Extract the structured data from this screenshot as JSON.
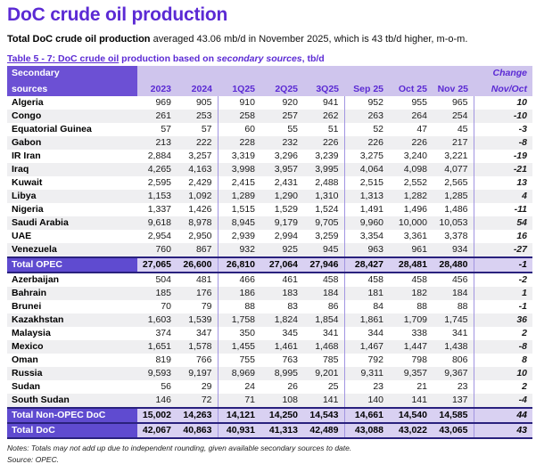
{
  "page": {
    "title": "DoC crude oil production",
    "intro_bold": "Total DoC crude oil production",
    "intro_rest": " averaged 43.06 mb/d in November 2025, which is 43 tb/d higher, m-o-m.",
    "caption_link": "Table 5 - 7: DoC crude oil",
    "caption_mid": " production based on ",
    "caption_italic": "secondary sources",
    "caption_end": ", tb/d",
    "notes": "Notes: Totals may not add up due to independent rounding, given available secondary sources to date.",
    "source": "Source: OPEC."
  },
  "colors": {
    "accent_purple": "#5b2ad4",
    "header_block_purple": "#6c50d4",
    "total_label_purple": "#5f4bd0",
    "header_lavender": "#cfc5ed",
    "total_lavender": "#d9d1f2",
    "band_gray": "#efeff1",
    "vline_purple": "#a295e1",
    "dark_border": "#29217d"
  },
  "table": {
    "header_label_line1": "Secondary",
    "header_label_line2": "sources",
    "columns": [
      "2023",
      "2024",
      "1Q25",
      "2Q25",
      "3Q25",
      "Sep 25",
      "Oct 25",
      "Nov 25"
    ],
    "change_line1": "Change",
    "change_line2": "Nov/Oct",
    "rows": [
      {
        "type": "data",
        "label": "Algeria",
        "values": [
          "969",
          "905",
          "910",
          "920",
          "941",
          "952",
          "955",
          "965"
        ],
        "change": "10"
      },
      {
        "type": "data",
        "label": "Congo",
        "values": [
          "261",
          "253",
          "258",
          "257",
          "262",
          "263",
          "264",
          "254"
        ],
        "change": "-10"
      },
      {
        "type": "data",
        "label": "Equatorial Guinea",
        "values": [
          "57",
          "57",
          "60",
          "55",
          "51",
          "52",
          "47",
          "45"
        ],
        "change": "-3"
      },
      {
        "type": "data",
        "label": "Gabon",
        "values": [
          "213",
          "222",
          "228",
          "232",
          "226",
          "226",
          "226",
          "217"
        ],
        "change": "-8"
      },
      {
        "type": "data",
        "label": "IR Iran",
        "values": [
          "2,884",
          "3,257",
          "3,319",
          "3,296",
          "3,239",
          "3,275",
          "3,240",
          "3,221"
        ],
        "change": "-19"
      },
      {
        "type": "data",
        "label": "Iraq",
        "values": [
          "4,265",
          "4,163",
          "3,998",
          "3,957",
          "3,995",
          "4,064",
          "4,098",
          "4,077"
        ],
        "change": "-21"
      },
      {
        "type": "data",
        "label": "Kuwait",
        "values": [
          "2,595",
          "2,429",
          "2,415",
          "2,431",
          "2,488",
          "2,515",
          "2,552",
          "2,565"
        ],
        "change": "13"
      },
      {
        "type": "data",
        "label": "Libya",
        "values": [
          "1,153",
          "1,092",
          "1,289",
          "1,290",
          "1,310",
          "1,313",
          "1,282",
          "1,285"
        ],
        "change": "4"
      },
      {
        "type": "data",
        "label": "Nigeria",
        "values": [
          "1,337",
          "1,426",
          "1,515",
          "1,529",
          "1,524",
          "1,491",
          "1,496",
          "1,486"
        ],
        "change": "-11"
      },
      {
        "type": "data",
        "label": "Saudi Arabia",
        "values": [
          "9,618",
          "8,978",
          "8,945",
          "9,179",
          "9,705",
          "9,960",
          "10,000",
          "10,053"
        ],
        "change": "54"
      },
      {
        "type": "data",
        "label": "UAE",
        "values": [
          "2,954",
          "2,950",
          "2,939",
          "2,994",
          "3,259",
          "3,354",
          "3,361",
          "3,378"
        ],
        "change": "16"
      },
      {
        "type": "data",
        "label": "Venezuela",
        "values": [
          "760",
          "867",
          "932",
          "925",
          "945",
          "963",
          "961",
          "934"
        ],
        "change": "-27"
      },
      {
        "type": "total",
        "label": "Total  OPEC",
        "values": [
          "27,065",
          "26,600",
          "26,810",
          "27,064",
          "27,946",
          "28,427",
          "28,481",
          "28,480"
        ],
        "change": "-1"
      },
      {
        "type": "data",
        "label": "Azerbaijan",
        "values": [
          "504",
          "481",
          "466",
          "461",
          "458",
          "458",
          "458",
          "456"
        ],
        "change": "-2"
      },
      {
        "type": "data",
        "label": "Bahrain",
        "values": [
          "185",
          "176",
          "186",
          "183",
          "184",
          "181",
          "182",
          "184"
        ],
        "change": "1"
      },
      {
        "type": "data",
        "label": "Brunei",
        "values": [
          "70",
          "79",
          "88",
          "83",
          "86",
          "84",
          "88",
          "88"
        ],
        "change": "-1"
      },
      {
        "type": "data",
        "label": "Kazakhstan",
        "values": [
          "1,603",
          "1,539",
          "1,758",
          "1,824",
          "1,854",
          "1,861",
          "1,709",
          "1,745"
        ],
        "change": "36"
      },
      {
        "type": "data",
        "label": "Malaysia",
        "values": [
          "374",
          "347",
          "350",
          "345",
          "341",
          "344",
          "338",
          "341"
        ],
        "change": "2"
      },
      {
        "type": "data",
        "label": "Mexico",
        "values": [
          "1,651",
          "1,578",
          "1,455",
          "1,461",
          "1,468",
          "1,467",
          "1,447",
          "1,438"
        ],
        "change": "-8"
      },
      {
        "type": "data",
        "label": "Oman",
        "values": [
          "819",
          "766",
          "755",
          "763",
          "785",
          "792",
          "798",
          "806"
        ],
        "change": "8"
      },
      {
        "type": "data",
        "label": "Russia",
        "values": [
          "9,593",
          "9,197",
          "8,969",
          "8,995",
          "9,201",
          "9,311",
          "9,357",
          "9,367"
        ],
        "change": "10"
      },
      {
        "type": "data",
        "label": "Sudan",
        "values": [
          "56",
          "29",
          "24",
          "26",
          "25",
          "23",
          "21",
          "23"
        ],
        "change": "2"
      },
      {
        "type": "data",
        "label": "South Sudan",
        "values": [
          "146",
          "72",
          "71",
          "108",
          "141",
          "140",
          "141",
          "137"
        ],
        "change": "-4"
      },
      {
        "type": "total",
        "label": "Total Non-OPEC DoC",
        "values": [
          "15,002",
          "14,263",
          "14,121",
          "14,250",
          "14,543",
          "14,661",
          "14,540",
          "14,585"
        ],
        "change": "44"
      },
      {
        "type": "total",
        "label": "Total DoC",
        "values": [
          "42,067",
          "40,863",
          "40,931",
          "41,313",
          "42,489",
          "43,088",
          "43,022",
          "43,065"
        ],
        "change": "43"
      }
    ]
  }
}
